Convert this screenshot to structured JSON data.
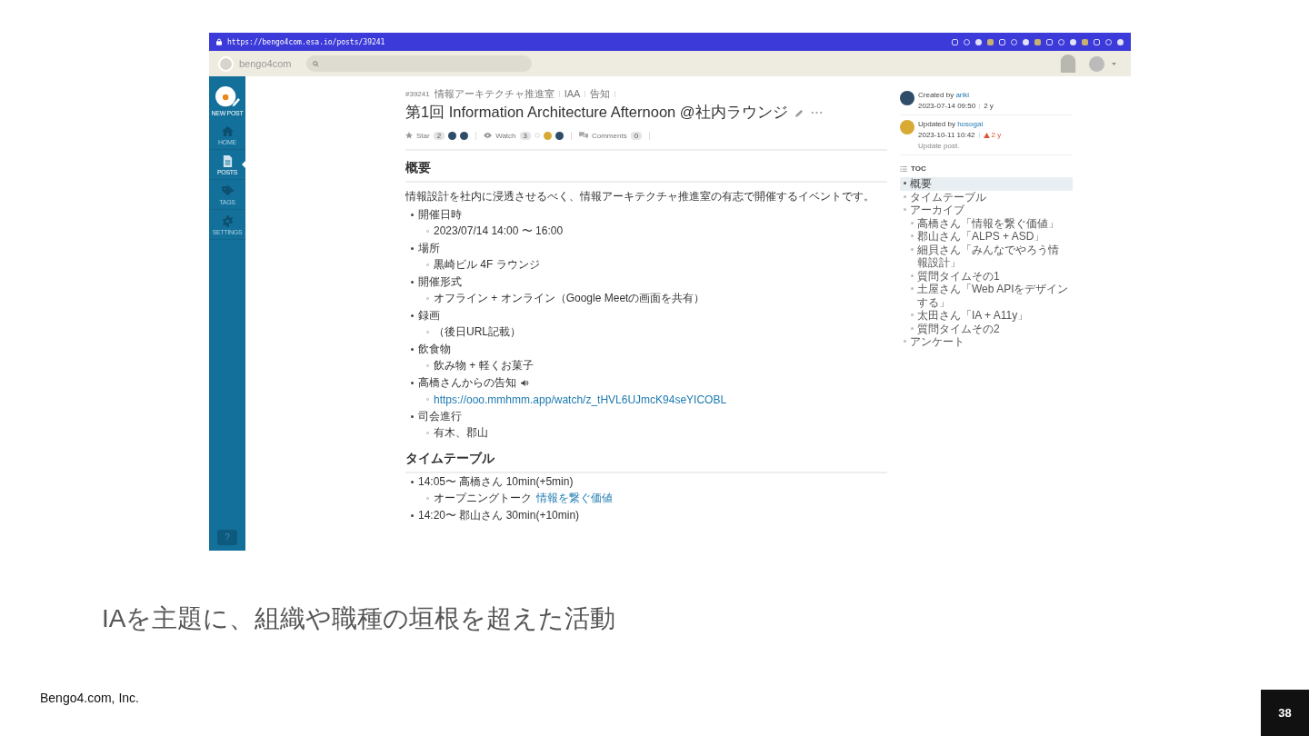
{
  "browser": {
    "url": "https://bengo4com.esa.io/posts/39241"
  },
  "app_header": {
    "team": "bengo4com"
  },
  "sidebar": {
    "new_post": "NEW POST",
    "items": [
      {
        "label": "HOME",
        "kind": "home",
        "selected": false
      },
      {
        "label": "POSTS",
        "kind": "posts",
        "selected": true
      },
      {
        "label": "TAGS",
        "kind": "tags",
        "selected": false
      },
      {
        "label": "SETTINGS",
        "kind": "settings",
        "selected": false
      }
    ],
    "help": "?"
  },
  "post": {
    "number": "#39241",
    "breadcrumbs": [
      "情報アーキテクチャ推進室",
      "IAA",
      "告知"
    ],
    "title": "第1回 Information Architecture Afternoon @社内ラウンジ",
    "star": {
      "label": "Star",
      "count": "2"
    },
    "watch": {
      "label": "Watch",
      "count": "3"
    },
    "comments": {
      "label": "Comments",
      "count": "0"
    },
    "sections": [
      {
        "heading": "概要",
        "paragraph": "情報設計を社内に浸透させるべく、情報アーキテクチャ推進室の有志で開催するイベントです。",
        "items": [
          {
            "text": "開催日時",
            "children": [
              {
                "text": "2023/07/14 14:00 〜 16:00"
              }
            ]
          },
          {
            "text": "場所",
            "children": [
              {
                "text": "黒崎ビル 4F ラウンジ"
              }
            ]
          },
          {
            "text": "開催形式",
            "children": [
              {
                "text": "オフライン + オンライン（Google Meetの画面を共有）"
              }
            ]
          },
          {
            "text": "録画",
            "children": [
              {
                "text": "（後日URL記載）"
              }
            ]
          },
          {
            "text": "飲食物",
            "children": [
              {
                "text": "飲み物 + 軽くお菓子"
              }
            ]
          },
          {
            "text": "高橋さんからの告知",
            "speaker": true,
            "children": [
              {
                "link": "https://ooo.mmhmm.app/watch/z_tHVL6UJmcK94seYICOBL"
              }
            ]
          },
          {
            "text": "司会進行",
            "children": [
              {
                "text": "有木、郡山"
              }
            ]
          }
        ]
      },
      {
        "heading": "タイムテーブル",
        "items": [
          {
            "text": "14:05〜 高橋さん 10min(+5min)",
            "children": [
              {
                "text": "オープニングトーク",
                "link": "情報を繋ぐ価値"
              }
            ]
          },
          {
            "text": "14:20〜 郡山さん 30min(+10min)"
          }
        ]
      }
    ]
  },
  "meta": {
    "created": {
      "label": "Created by",
      "user": "ariki",
      "date": "2023-07-14 09:50",
      "age": "2 y",
      "warning": false
    },
    "updated": {
      "label": "Updated by",
      "user": "hosogai",
      "date": "2023-10-11 10:42",
      "age": "2 y",
      "warning": true,
      "note": "Update post."
    }
  },
  "toc": {
    "title": "TOC",
    "items": [
      {
        "text": "概要",
        "selected": true
      },
      {
        "text": "タイムテーブル",
        "selected": false
      },
      {
        "text": "アーカイブ",
        "selected": false,
        "children": [
          {
            "text": "高橋さん「情報を繋ぐ価値」",
            "selected": false
          },
          {
            "text": "郡山さん「ALPS + ASD」",
            "selected": false
          },
          {
            "text": "細貝さん「みんなでやろう情報設計」",
            "selected": false
          },
          {
            "text": "質問タイムその1",
            "selected": false
          },
          {
            "text": "土屋さん「Web APIをデザインする」",
            "selected": false
          },
          {
            "text": "太田さん「IA + A11y」",
            "selected": false
          },
          {
            "text": "質問タイムその2",
            "selected": false
          }
        ]
      },
      {
        "text": "アンケート",
        "selected": false
      }
    ]
  },
  "slide": {
    "caption": "IAを主題に、組織や職種の垣根を超えた活動",
    "footer": "Bengo4.com, Inc.",
    "page_number": "38"
  }
}
